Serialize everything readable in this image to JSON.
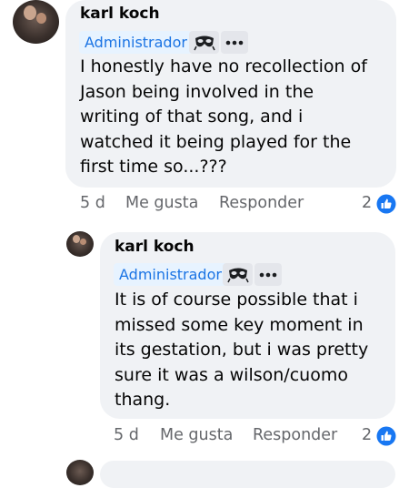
{
  "comments": [
    {
      "author": "karl koch",
      "badge": "Administrador",
      "text_lines": [
        "I honestly have no recollection of",
        "Jason being involved in the",
        "writing of that song, and i",
        "watched it being played for the",
        "first time so...???"
      ],
      "time": "5 d",
      "like_label": "Me gusta",
      "reply_label": "Responder",
      "reaction_count": "2"
    },
    {
      "author": "karl koch",
      "badge": "Administrador",
      "text_lines": [
        "It is of course possible that i",
        "missed some key moment in",
        "its gestation, but i was pretty",
        "sure it was a wilson/cuomo",
        "thang."
      ],
      "time": "5 d",
      "like_label": "Me gusta",
      "reply_label": "Responder",
      "reaction_count": "2"
    }
  ],
  "icons": {
    "badge_icon": "anonymous-mask-icon",
    "more_icon": "more-options-icon",
    "reaction_icon": "like-icon"
  },
  "colors": {
    "bubble": "#f0f2f5",
    "admin_text": "#1b74e4",
    "admin_bg": "#e7f3ff",
    "like_blue": "#1877f2",
    "muted": "#65676b"
  }
}
